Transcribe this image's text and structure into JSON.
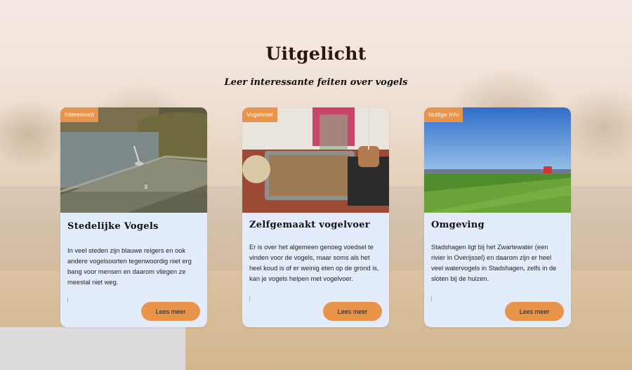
{
  "section": {
    "title": "Uitgelicht",
    "subtitle": "Leer interessante feiten over vogels"
  },
  "cards": [
    {
      "badge": "Interessant",
      "title": "Stedelijke Vogels",
      "text": "In veel steden zijn blauwe reigers en ook andere vogelsoorten tegenwoordig niet erg bang voor mensen en daarom vliegen ze meestal niet weg.",
      "button": "Lees meer",
      "image": "heron-on-jetty-photo"
    },
    {
      "badge": "Vogelvoer",
      "title": "Zelfgemaakt vogelvoer",
      "text": "Er is over het algemeen genoeg voedsel te vinden voor de vogels, maar soms als het heel koud is of er weinig eten op de grond is, kan je vogels helpen met vogelvoer.",
      "button": "Lees meer",
      "image": "homemade-birdfood-photo"
    },
    {
      "badge": "Nuttige Info",
      "title": "Omgeving",
      "text": "Stadshagen ligt bij het Zwartewater (een rivier in Overijssel) en daarom zijn er heel veel watervogels in Stadshagen, zelfs in de sloten bij de huizen.",
      "button": "Lees meer",
      "image": "stadshagen-landscape-photo"
    }
  ],
  "colors": {
    "accent": "#e8944a",
    "card_bg": "#e3ecfa",
    "heading": "#2a160c"
  }
}
